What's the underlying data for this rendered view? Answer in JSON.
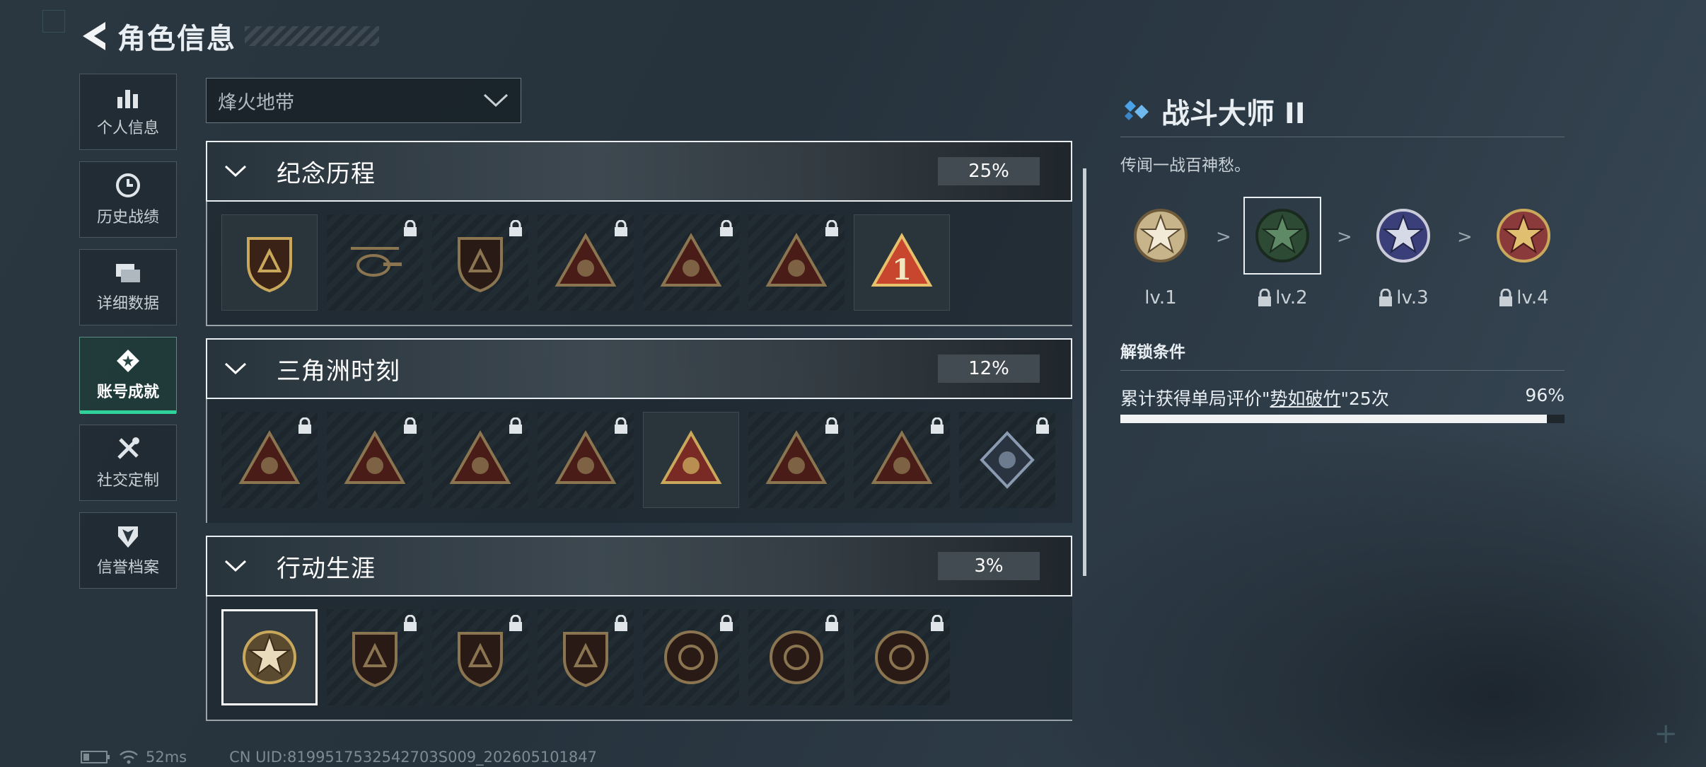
{
  "header": {
    "title": "角色信息"
  },
  "sidebar": {
    "items": [
      {
        "label": "个人信息",
        "icon": "bar-chart-icon",
        "active": false
      },
      {
        "label": "历史战绩",
        "icon": "history-clock-icon",
        "active": false
      },
      {
        "label": "详细数据",
        "icon": "data-cards-icon",
        "active": false
      },
      {
        "label": "账号成就",
        "icon": "achievement-star-icon",
        "active": true
      },
      {
        "label": "社交定制",
        "icon": "tools-icon",
        "active": false
      },
      {
        "label": "信誉档案",
        "icon": "shield-rank-icon",
        "active": false
      }
    ]
  },
  "mode_dropdown": {
    "value": "烽火地带"
  },
  "sections": [
    {
      "name": "纪念历程",
      "percent": "25%",
      "badges": [
        {
          "icon": "mountain-shield-badge-icon",
          "locked": false
        },
        {
          "icon": "helicopter-badge-icon",
          "locked": true
        },
        {
          "icon": "diamond-shield-badge-icon",
          "locked": true
        },
        {
          "icon": "soldier-triangle-badge-icon",
          "locked": true
        },
        {
          "icon": "face-triangle-badge-icon",
          "locked": true
        },
        {
          "icon": "squad-triangle-badge-icon",
          "locked": true
        },
        {
          "icon": "number-one-triangle-badge-icon",
          "locked": false
        }
      ]
    },
    {
      "name": "三角洲时刻",
      "percent": "12%",
      "badges": [
        {
          "icon": "vault-triangle-badge-icon",
          "locked": true
        },
        {
          "icon": "robot-triangle-badge-icon",
          "locked": true
        },
        {
          "icon": "operators-triangle-badge-icon",
          "locked": true
        },
        {
          "icon": "dice-triangle-badge-icon",
          "locked": true
        },
        {
          "icon": "team-triangle-badge-icon",
          "locked": false
        },
        {
          "icon": "crowd-triangle-badge-icon",
          "locked": true
        },
        {
          "icon": "bird-triangle-badge-icon",
          "locked": true
        },
        {
          "icon": "rose-diamond-badge-icon",
          "locked": true
        }
      ]
    },
    {
      "name": "行动生涯",
      "percent": "3%",
      "badges": [
        {
          "icon": "star-medal-badge-icon",
          "locked": false,
          "selected": true
        },
        {
          "icon": "hand-shield-badge-icon",
          "locked": true
        },
        {
          "icon": "wing-shield-badge-icon",
          "locked": true
        },
        {
          "icon": "gem-shield-badge-icon",
          "locked": true
        },
        {
          "icon": "ring-medal-badge-icon",
          "locked": true
        },
        {
          "icon": "skull-medal-badge-icon",
          "locked": true
        },
        {
          "icon": "eye-medal-badge-icon",
          "locked": true
        }
      ]
    }
  ],
  "detail": {
    "title": "战斗大师 II",
    "description": "传闻一战百神愁。",
    "levels": [
      {
        "label": "lv.1",
        "locked": false,
        "color": "#c8b48a"
      },
      {
        "label": "lv.2",
        "locked": true,
        "color": "#3f6a48"
      },
      {
        "label": "lv.3",
        "locked": true,
        "color": "#4a4f8a"
      },
      {
        "label": "lv.4",
        "locked": true,
        "color": "#8a3a3a"
      }
    ],
    "arrow": ">",
    "unlock_title": "解锁条件",
    "condition_prefix": "累计获得单局评价\"",
    "condition_highlight": "势如破竹",
    "condition_suffix": "\"25次",
    "progress_text": "96%",
    "progress": 0.96
  },
  "footer": {
    "ping": "52ms",
    "uid": "CN UID:8199517532542703S009_202605101847"
  },
  "colors": {
    "accent_green": "#2fd39a",
    "badge_gold": "#c9a85c",
    "badge_red": "#7a2a24",
    "diamond_blue": "#4aa3e8"
  }
}
